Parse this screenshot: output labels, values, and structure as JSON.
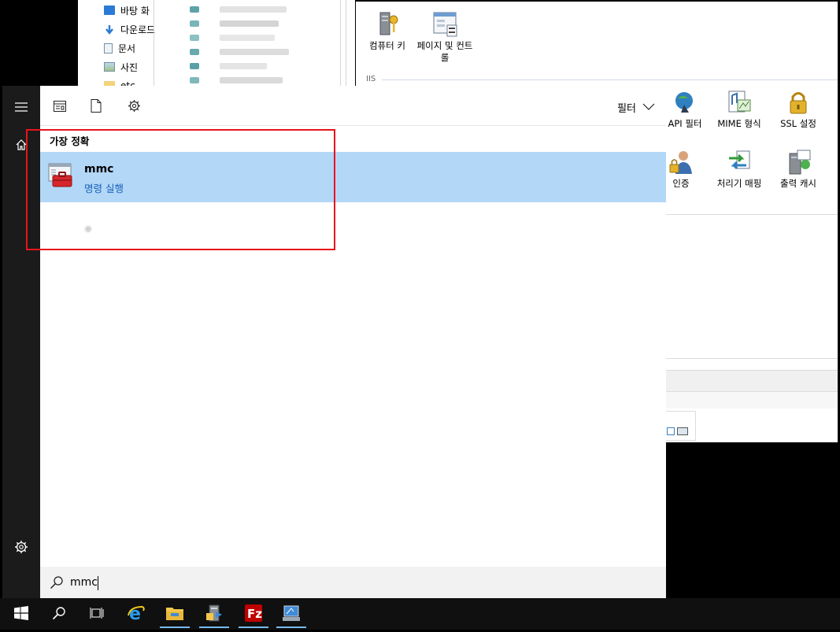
{
  "explorer": {
    "nav_items": [
      {
        "label": "바탕 화",
        "icon": "desktop-icon"
      },
      {
        "label": "다운로드",
        "icon": "download-arrow-icon"
      },
      {
        "label": "문서",
        "icon": "document-icon"
      },
      {
        "label": "사진",
        "icon": "picture-icon"
      },
      {
        "label": "etc",
        "icon": "folder-icon"
      }
    ]
  },
  "iis": {
    "top_features": [
      {
        "label": "컴퓨터 키",
        "icon": "machine-key-icon"
      },
      {
        "label": "페이지 및 컨트롤",
        "icon": "pages-controls-icon"
      }
    ],
    "group_label": "IIS",
    "features_row1": [
      {
        "label": "API 필터",
        "icon": "isapi-filter-icon"
      },
      {
        "label": "MIME 형식",
        "icon": "mime-types-icon"
      },
      {
        "label": "SSL 설정",
        "icon": "ssl-lock-icon"
      }
    ],
    "features_row2": [
      {
        "label": "인증",
        "icon": "authentication-icon"
      },
      {
        "label": "처리기 매핑",
        "icon": "handler-mappings-icon"
      },
      {
        "label": "출력 캐시",
        "icon": "output-cache-icon"
      }
    ]
  },
  "start_menu": {
    "rail": {
      "menu_icon": "hamburger-icon",
      "home_icon": "home-icon",
      "settings_icon": "gear-icon"
    },
    "header": {
      "filter_label": "필터"
    },
    "best_match": {
      "heading": "가장 정확",
      "app_name": "mmc",
      "app_type": "명령 실행"
    },
    "search": {
      "query": "mmc"
    }
  },
  "taskbar": {
    "apps": [
      {
        "name": "start",
        "icon": "windows-logo-icon"
      },
      {
        "name": "search",
        "icon": "search-icon"
      },
      {
        "name": "task-view",
        "icon": "task-view-icon"
      },
      {
        "name": "internet-explorer",
        "icon": "internet-explorer-icon"
      },
      {
        "name": "file-explorer",
        "icon": "folder-icon",
        "active": true
      },
      {
        "name": "server-manager",
        "icon": "server-manager-icon",
        "active": true
      },
      {
        "name": "filezilla",
        "icon": "filezilla-icon",
        "active": true
      },
      {
        "name": "remote-desktop",
        "icon": "remote-desktop-icon",
        "active": true
      }
    ]
  },
  "colors": {
    "selection": "#b3d7f7",
    "link_blue": "#1560b8",
    "annotation_red": "#e8141c",
    "rail": "#1b1b1b",
    "taskbar": "#101010"
  }
}
